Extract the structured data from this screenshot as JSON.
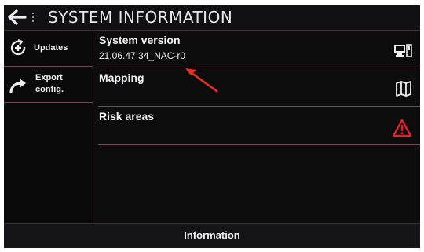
{
  "header": {
    "title": "SYSTEM INFORMATION",
    "back_icon": "back-arrow-icon",
    "menu_icon": "kebab-menu-icon"
  },
  "sidebar": {
    "items": [
      {
        "label": "Updates",
        "icon": "update-icon"
      },
      {
        "label_line1": "Export",
        "label_line2": "config.",
        "icon": "export-arrow-icon"
      }
    ]
  },
  "main": {
    "rows": [
      {
        "title": "System version",
        "value": "21.06.47.34_NAC-r0",
        "icon": "monitor-icon"
      },
      {
        "title": "Mapping",
        "icon": "map-icon"
      },
      {
        "title": "Risk areas",
        "icon": "warning-icon"
      }
    ]
  },
  "footer": {
    "label": "Information"
  },
  "colors": {
    "background": "#0c0c0d",
    "divider": "#6e4e5b",
    "text": "#f0eef0",
    "warning": "#e0232a",
    "annotation_arrow": "#e8301f"
  }
}
